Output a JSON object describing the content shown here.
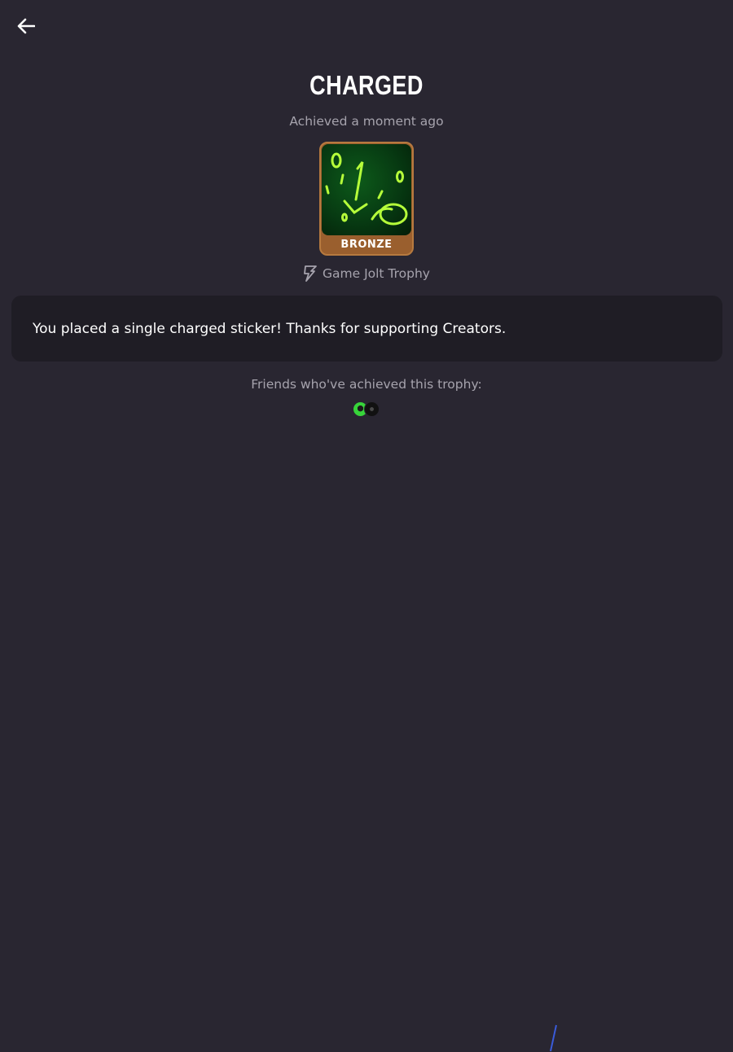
{
  "header": {
    "back_label": "Back"
  },
  "trophy": {
    "title": "CHARGED",
    "achieved_text": "Achieved a moment ago",
    "tier": "BRONZE",
    "tier_color": "#9a5f2e",
    "source_icon": "lightning-bolt-icon",
    "source_text": "Game Jolt Trophy",
    "description": "You placed a single charged sticker! Thanks for supporting Creators."
  },
  "friends": {
    "label": "Friends who've achieved this trophy:",
    "avatars": [
      "green-avatar",
      "dark-avatar"
    ]
  },
  "colors": {
    "background": "#292631",
    "card": "#1f1d25",
    "muted_text": "#a6a3ad"
  }
}
